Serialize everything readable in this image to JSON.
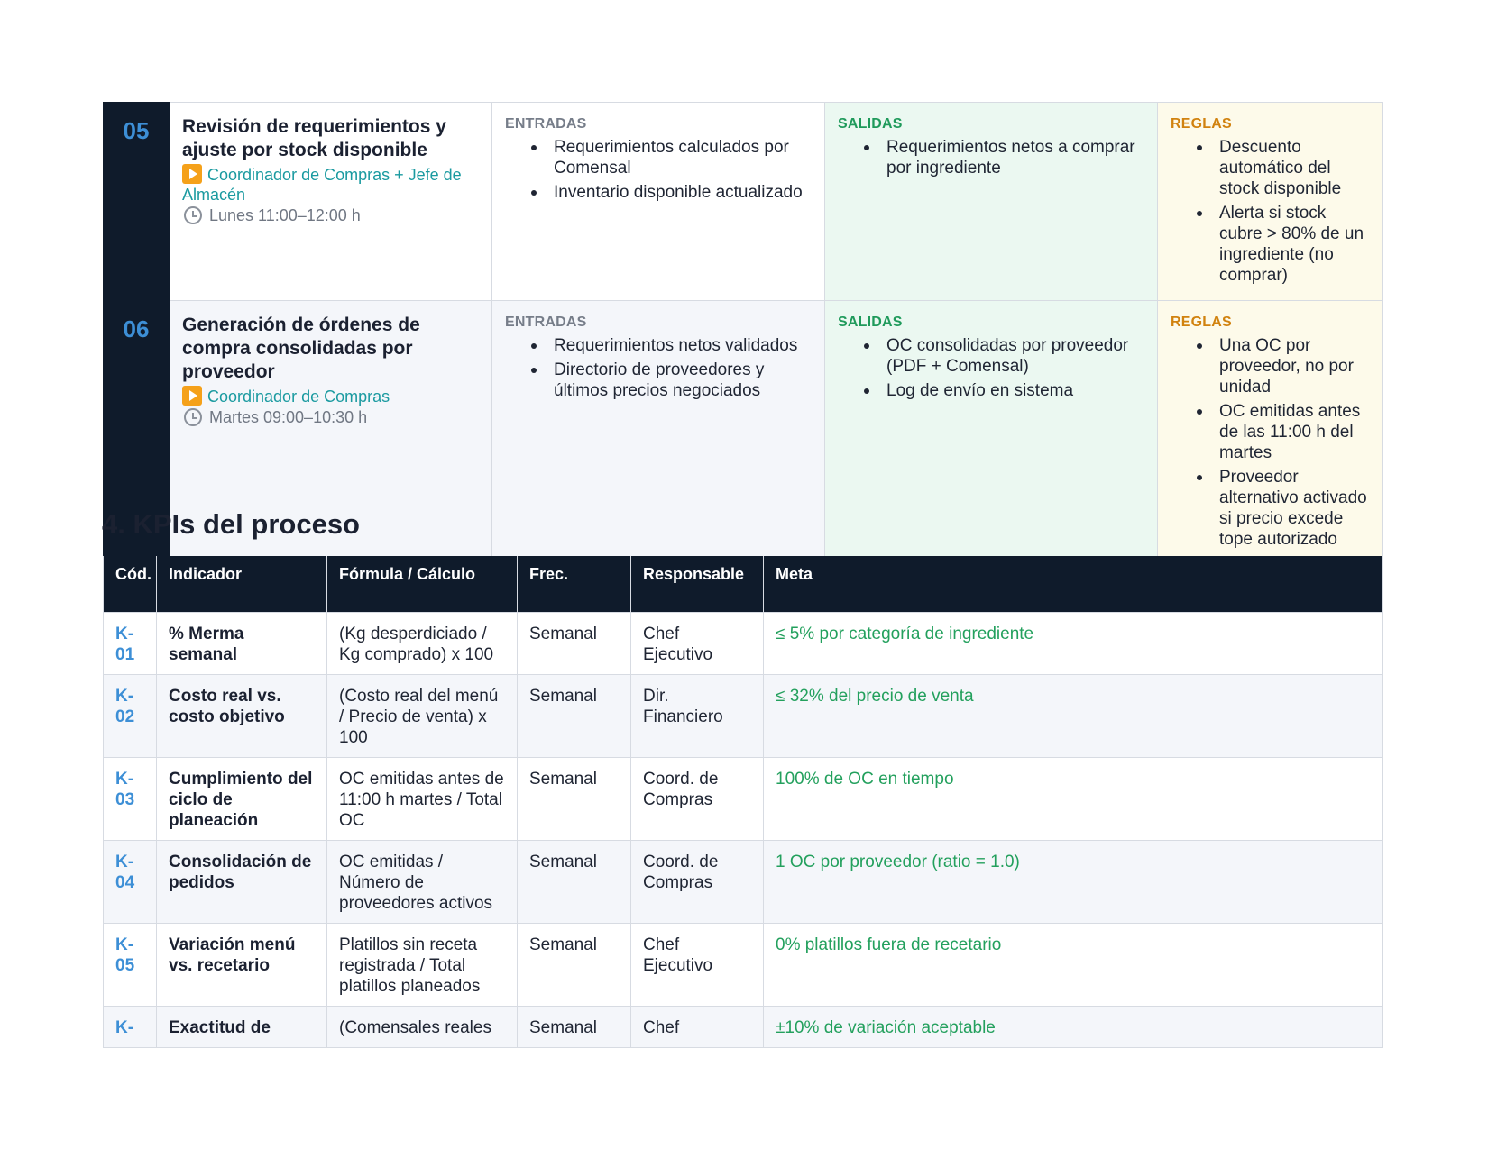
{
  "steps": [
    {
      "number": "05",
      "title": "Revisión de requerimientos y ajuste por stock disponible",
      "role": "Coordinador de Compras + Jefe de Almacén",
      "time": "Lunes 11:00–12:00 h",
      "entradas_label": "ENTRADAS",
      "entradas": [
        "Requerimientos calculados por Comensal",
        "Inventario disponible actualizado"
      ],
      "salidas_label": "SALIDAS",
      "salidas": [
        "Requerimientos netos a comprar por ingrediente"
      ],
      "reglas_label": "REGLAS",
      "reglas": [
        "Descuento automático del stock disponible",
        "Alerta si stock cubre > 80% de un ingrediente (no comprar)"
      ]
    },
    {
      "number": "06",
      "title": "Generación de órdenes de compra consolidadas por proveedor",
      "role": "Coordinador de Compras",
      "time": "Martes 09:00–10:30 h",
      "entradas_label": "ENTRADAS",
      "entradas": [
        "Requerimientos netos validados",
        "Directorio de proveedores y últimos precios negociados"
      ],
      "salidas_label": "SALIDAS",
      "salidas": [
        "OC consolidadas por proveedor (PDF + Comensal)",
        "Log de envío en sistema"
      ],
      "reglas_label": "REGLAS",
      "reglas": [
        "Una OC por proveedor, no por unidad",
        "OC emitidas antes de las 11:00 h del martes",
        "Proveedor alternativo activado si precio excede tope autorizado"
      ]
    }
  ],
  "kpi_section": {
    "title": "4. KPIs del proceso",
    "headers": {
      "code": "Cód.",
      "indicator": "Indicador",
      "formula": "Fórmula / Cálculo",
      "freq": "Frec.",
      "owner": "Responsable",
      "goal": "Meta"
    },
    "rows": [
      {
        "code": "K-01",
        "indicator": "% Merma semanal",
        "formula": "(Kg desperdiciado / Kg comprado) x 100",
        "freq": "Semanal",
        "owner": "Chef Ejecutivo",
        "goal": "≤ 5% por categoría de ingrediente"
      },
      {
        "code": "K-02",
        "indicator": "Costo real vs. costo objetivo",
        "formula": "(Costo real del menú / Precio de venta) x 100",
        "freq": "Semanal",
        "owner": "Dir. Financiero",
        "goal": "≤ 32% del precio de venta"
      },
      {
        "code": "K-03",
        "indicator": "Cumplimiento del ciclo de planeación",
        "formula": "OC emitidas antes de 11:00 h martes / Total OC",
        "freq": "Semanal",
        "owner": "Coord. de Compras",
        "goal": "100% de OC en tiempo"
      },
      {
        "code": "K-04",
        "indicator": "Consolidación de pedidos",
        "formula": "OC emitidas / Número de proveedores activos",
        "freq": "Semanal",
        "owner": "Coord. de Compras",
        "goal": "1 OC por proveedor (ratio = 1.0)"
      },
      {
        "code": "K-05",
        "indicator": "Variación menú vs. recetario",
        "formula": "Platillos sin receta registrada / Total platillos planeados",
        "freq": "Semanal",
        "owner": "Chef Ejecutivo",
        "goal": "0% platillos fuera de recetario"
      },
      {
        "code": "K-",
        "indicator": "Exactitud de",
        "formula": "(Comensales reales",
        "freq": "Semanal",
        "owner": "Chef",
        "goal": "±10% de variación aceptable"
      }
    ]
  }
}
